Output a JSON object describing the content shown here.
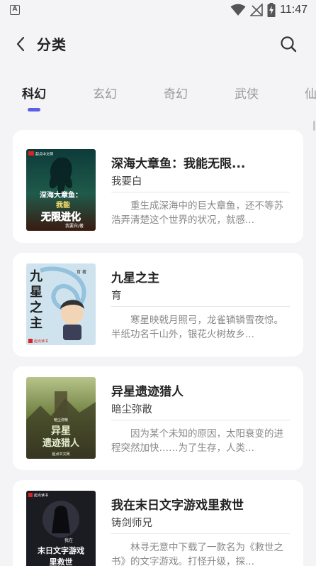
{
  "status_bar": {
    "notification_icon": "A",
    "time": "11:47"
  },
  "header": {
    "title": "分类"
  },
  "tabs": [
    {
      "label": "科幻",
      "active": true
    },
    {
      "label": "玄幻",
      "active": false
    },
    {
      "label": "奇幻",
      "active": false
    },
    {
      "label": "武侠",
      "active": false
    },
    {
      "label": "仙",
      "active": false
    }
  ],
  "colors": {
    "accent": "#5b5fe6",
    "background": "#f4f4f6",
    "card": "#ffffff"
  },
  "books": [
    {
      "title": "深海大章鱼：我能无限...",
      "author": "我要白",
      "description": "重生成深海中的巨大章鱼，还不等苏浩弄清楚这个世界的状况，就感...",
      "cover": {
        "lines": [
          "深海大章鱼：",
          "我能",
          "无限进化"
        ],
        "byline": "我要白/著",
        "badge": "起点中文网"
      }
    },
    {
      "title": "九星之主",
      "author": "育",
      "description": "寒星映戟月照弓，龙雀辚辚雪夜惊。半纸功名千山外，银花火树故乡...",
      "cover": {
        "lines": [
          "九",
          "星",
          "之",
          "主"
        ],
        "byline": "育 著",
        "badge": "起点读书"
      }
    },
    {
      "title": "异星遗迹猎人",
      "author": "暗尘弥散",
      "description": "因为某个未知的原因，太阳衰变的进程突然加快……为了生存，人类...",
      "cover": {
        "lines": [
          "异星",
          "遗迹猎人"
        ],
        "byline": "暗尘弥散",
        "badge": "起点中文网"
      }
    },
    {
      "title": "我在末日文字游戏里救世",
      "author": "铸剑师兄",
      "description": "林寻无意中下载了一款名为《救世之书》的文字游戏。打怪升级，探...",
      "cover": {
        "lines": [
          "我在",
          "末日文字游戏",
          "里救世"
        ],
        "byline": "",
        "badge": "起点读书"
      }
    }
  ]
}
